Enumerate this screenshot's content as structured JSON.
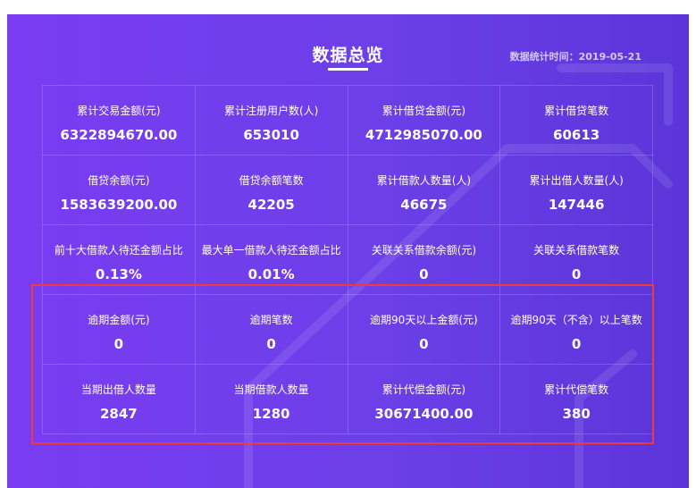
{
  "header": {
    "title": "数据总览",
    "stat_time": "数据统计时间：2019-05-21"
  },
  "rows": [
    [
      {
        "label": "累计交易金额(元)",
        "value": "6322894670.00"
      },
      {
        "label": "累计注册用户数(人)",
        "value": "653010"
      },
      {
        "label": "累计借贷金额(元)",
        "value": "4712985070.00"
      },
      {
        "label": "累计借贷笔数",
        "value": "60613"
      }
    ],
    [
      {
        "label": "借贷余额(元)",
        "value": "1583639200.00"
      },
      {
        "label": "借贷余额笔数",
        "value": "42205"
      },
      {
        "label": "累计借款人数量(人)",
        "value": "46675"
      },
      {
        "label": "累计出借人数量(人)",
        "value": "147446"
      }
    ],
    [
      {
        "label": "前十大借款人待还金额占比",
        "value": "0.13%"
      },
      {
        "label": "最大单一借款人待还金额占比",
        "value": "0.01%"
      },
      {
        "label": "关联关系借款余额(元)",
        "value": "0"
      },
      {
        "label": "关联关系借款笔数",
        "value": "0"
      }
    ],
    [
      {
        "label": "逾期金额(元)",
        "value": "0"
      },
      {
        "label": "逾期笔数",
        "value": "0"
      },
      {
        "label": "逾期90天以上金额(元)",
        "value": "0"
      },
      {
        "label": "逾期90天（不含）以上笔数",
        "value": "0"
      }
    ],
    [
      {
        "label": "当期出借人数量",
        "value": "2847"
      },
      {
        "label": "当期借款人数量",
        "value": "1280"
      },
      {
        "label": "累计代偿金额(元)",
        "value": "30671400.00"
      },
      {
        "label": "累计代偿笔数",
        "value": "380"
      }
    ]
  ],
  "colors": {
    "panel_start": "#7a3cf2",
    "panel_end": "#5b35d9",
    "highlight_border": "#ee3b3b"
  }
}
